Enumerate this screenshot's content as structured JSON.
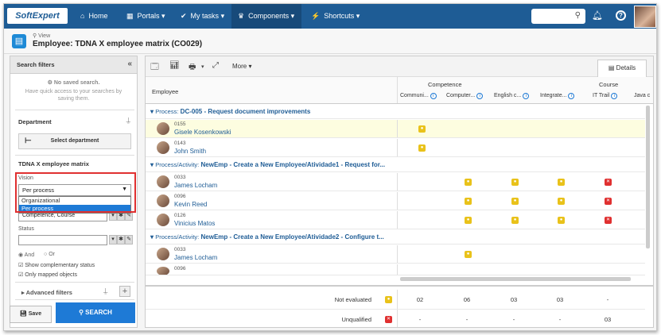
{
  "nav": {
    "logo": "SoftExpert",
    "items": [
      {
        "label": "Home",
        "icon": "⌂"
      },
      {
        "label": "Portals",
        "icon": "▦"
      },
      {
        "label": "My tasks",
        "icon": "✔"
      },
      {
        "label": "Components",
        "icon": "♛"
      },
      {
        "label": "Shortcuts",
        "icon": "⚡"
      }
    ]
  },
  "title": {
    "view_label": "View",
    "page_title": "Employee: TDNA X employee matrix (CO029)"
  },
  "filters": {
    "header": "Search filters",
    "no_saved": "No saved search.",
    "no_saved_sub": "Have quick access to your searches by saving them.",
    "department_title": "Department",
    "select_department": "Select department",
    "matrix_title": "TDNA X employee matrix",
    "vision_label": "Vision",
    "vision_value": "Per process",
    "vision_options": [
      "Organizational",
      "Per process"
    ],
    "second_select": "Competence, Course",
    "status_label": "Status",
    "and_label": "And",
    "or_label": "Or",
    "show_complementary": "Show complementary status",
    "only_mapped": "Only mapped objects",
    "advanced_filters": "Advanced filters",
    "save": "Save",
    "search": "SEARCH"
  },
  "toolbar": {
    "more": "More",
    "details": "Details"
  },
  "grid": {
    "employee_header": "Employee",
    "competence_header": "Competence",
    "course_header": "Course",
    "columns": [
      "Communi...",
      "Computer...",
      "English c...",
      "Integrate...",
      "IT Trail",
      "Java c"
    ],
    "groups": [
      {
        "prefix": "Process:",
        "title": "DC-005 - Request document improvements"
      },
      {
        "prefix": "Process/Activity:",
        "title": "NewEmp - Create a New Employee/Atividade1 - Request for..."
      },
      {
        "prefix": "Process/Activity:",
        "title": "NewEmp - Create a New Employee/Atividade2 - Configure t..."
      }
    ],
    "employees": [
      {
        "code": "0155",
        "name": "Gisele Kosenkowski"
      },
      {
        "code": "0143",
        "name": "John Smith"
      },
      {
        "code": "0033",
        "name": "James Locham"
      },
      {
        "code": "0096",
        "name": "Kevin Reed"
      },
      {
        "code": "0126",
        "name": "Vinicius Matos"
      },
      {
        "code": "0033",
        "name": "James Locham"
      },
      {
        "code": "0096",
        "name": ""
      }
    ]
  },
  "summary": {
    "not_evaluated_label": "Not evaluated",
    "not_evaluated_values": [
      "02",
      "06",
      "03",
      "03",
      "-"
    ],
    "unqualified_label": "Unqualified",
    "unqualified_values": [
      "-",
      "-",
      "-",
      "-",
      "03"
    ]
  },
  "colors": {
    "brand": "#1e5c95",
    "accent": "#1e7ad6",
    "not_evaluated": "#e9c21a",
    "unqualified": "#e03030"
  }
}
